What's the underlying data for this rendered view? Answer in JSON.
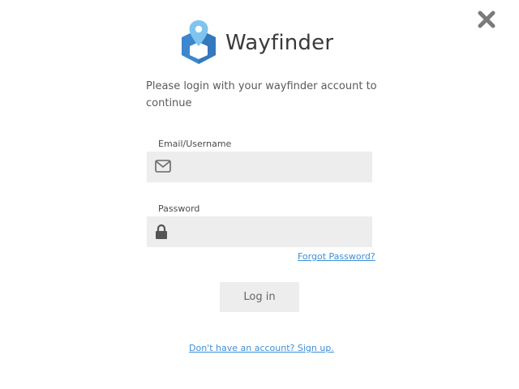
{
  "app": {
    "name": "Wayfinder",
    "logo_icon": "wayfinder-pin-logo",
    "brand_color": "#3d87cf"
  },
  "intro_text": "Please login with your wayfinder account to continue",
  "email": {
    "label": "Email/Username",
    "value": "",
    "icon": "envelope-icon"
  },
  "password": {
    "label": "Password",
    "value": "",
    "icon": "lock-icon"
  },
  "forgot_password": "Forgot Password?",
  "login_button": "Log in",
  "signup_link": "Don't have an account? Sign up.",
  "close_icon": "close-icon",
  "colors": {
    "link": "#3d8fd6",
    "field_bg": "#ededed"
  }
}
